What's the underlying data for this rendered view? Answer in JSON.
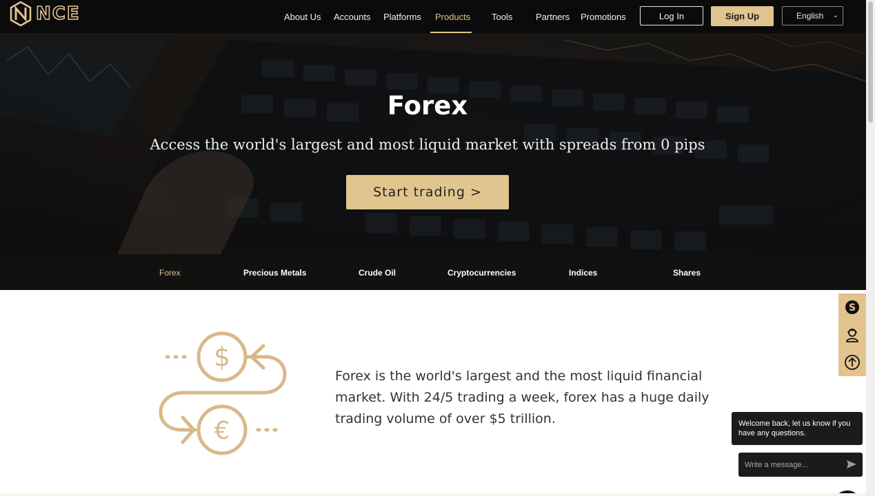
{
  "header": {
    "brand": "NCE",
    "nav": [
      {
        "label": "About Us"
      },
      {
        "label": "Accounts"
      },
      {
        "label": "Platforms"
      },
      {
        "label": "Products"
      },
      {
        "label": "Tools"
      },
      {
        "label": "Partners"
      },
      {
        "label": "Promotions"
      }
    ],
    "active_nav": "Products",
    "login_label": "Log In",
    "signup_label": "Sign Up",
    "language": "English"
  },
  "hero": {
    "title": "Forex",
    "subtitle": "Access the world's largest and most liquid market with spreads from 0 pips",
    "cta_label": "Start trading >"
  },
  "product_tabs": [
    {
      "label": "Forex"
    },
    {
      "label": "Precious Metals"
    },
    {
      "label": "Crude Oil"
    },
    {
      "label": "Cryptocurrencies"
    },
    {
      "label": "Indices"
    },
    {
      "label": "Shares"
    }
  ],
  "active_tab": "Forex",
  "content": {
    "description": "Forex is the world's largest and the most liquid financial market. With 24/5 trading a week, forex has a huge daily trading volume of over $5 trillion.",
    "illustration_icons": [
      "dollar-coin-icon",
      "euro-coin-icon"
    ]
  },
  "side_buttons": [
    "skype-icon",
    "support-agent-icon",
    "back-to-top-icon"
  ],
  "chat": {
    "welcome": "Welcome back, let us know if you have any questions.",
    "placeholder": "Write a message..."
  },
  "colors": {
    "accent_gold": "#e1c58f",
    "header_bg": "#0b0b0b",
    "tabs_bg": "#121110"
  }
}
